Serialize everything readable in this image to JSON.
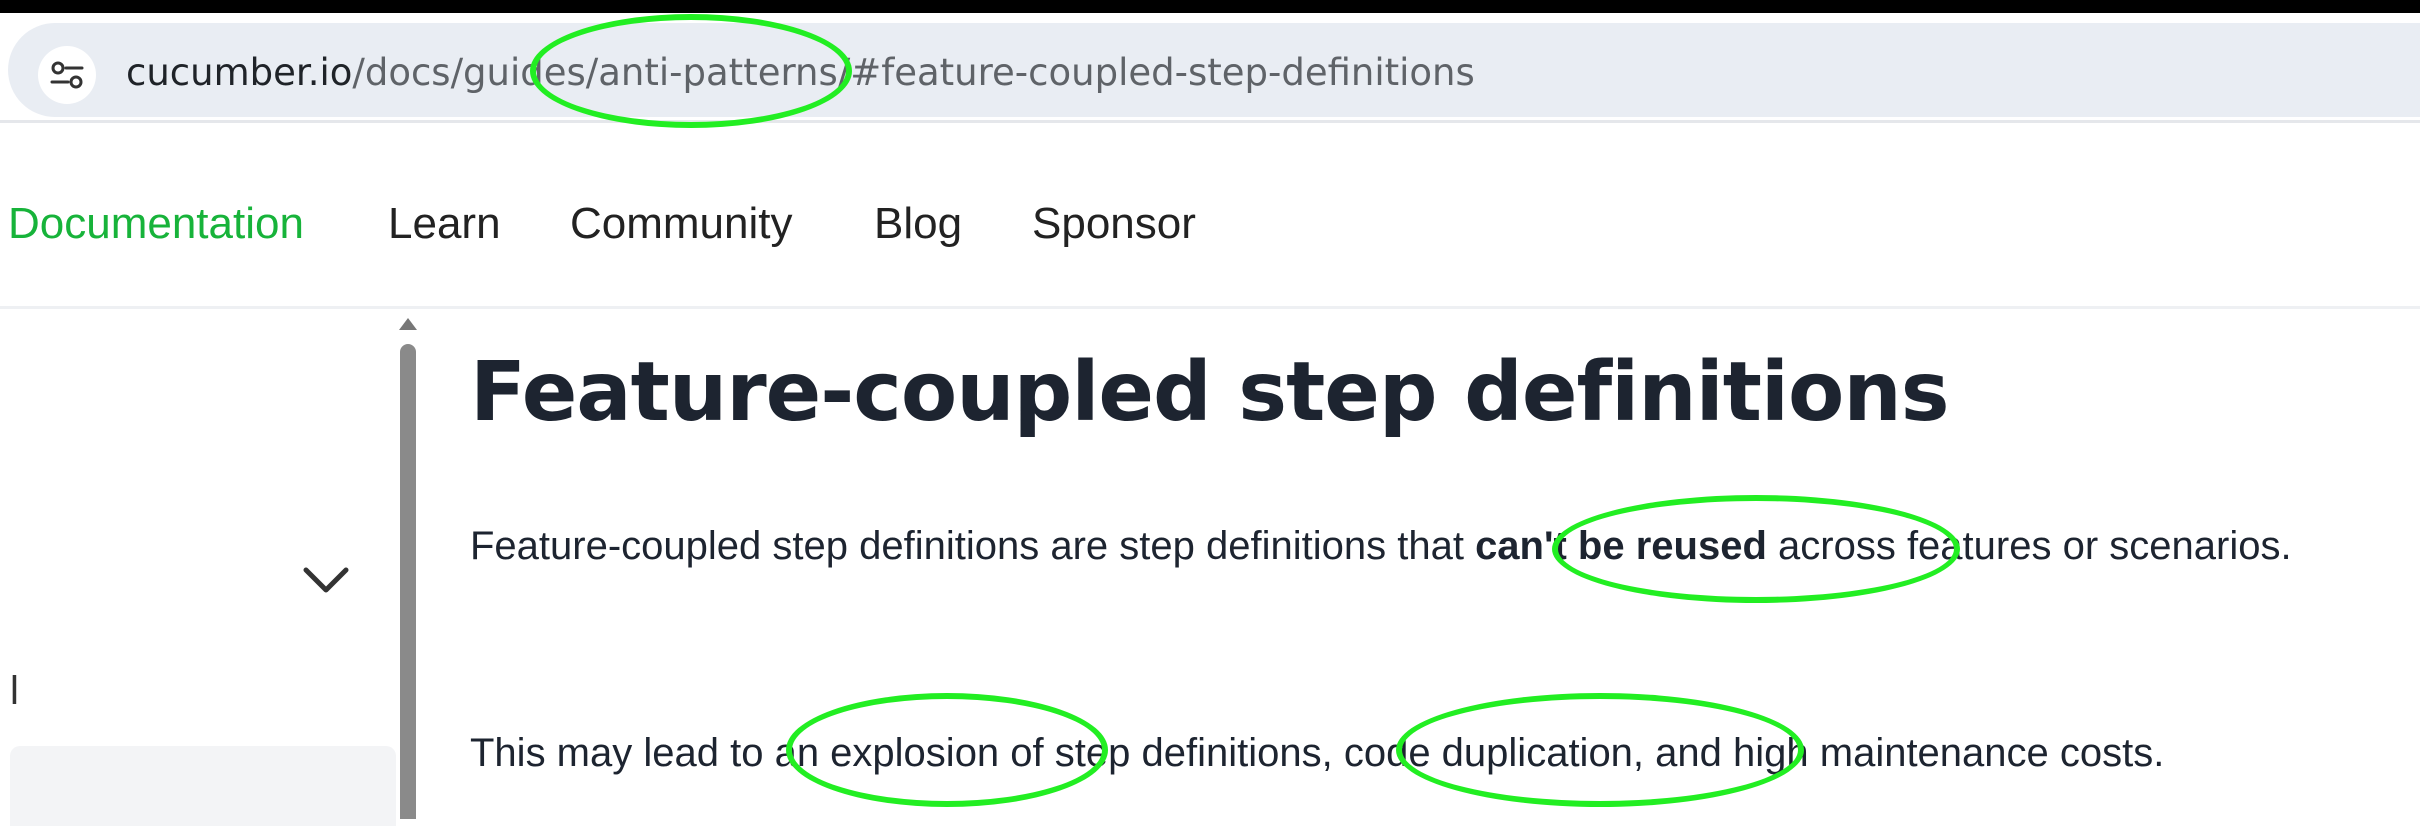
{
  "browser": {
    "url_host": "cucumber.io",
    "url_path": "/docs/guides/anti-patterns/#feature-coupled-step-definitions",
    "site_settings_icon": "tune-icon"
  },
  "nav": {
    "items": [
      {
        "label": "Documentation",
        "active": true
      },
      {
        "label": "Learn"
      },
      {
        "label": "Community"
      },
      {
        "label": "Blog"
      },
      {
        "label": "Sponsor"
      }
    ]
  },
  "sidebar": {
    "fragment_text": "l",
    "expand_icon": "chevron-down-icon"
  },
  "article": {
    "heading": "Feature-coupled step definitions",
    "p1_before": "Feature-coupled step definitions are step definitions that ",
    "p1_bold": "can't be reused",
    "p1_after": " across features or scenarios.",
    "p2": "This may lead to an explosion of step definitions, code duplication, and high maintenance costs."
  },
  "colors": {
    "accent_green": "#17b33a",
    "annotation": "#22ee22",
    "url_bar_bg": "#e9edf3"
  }
}
